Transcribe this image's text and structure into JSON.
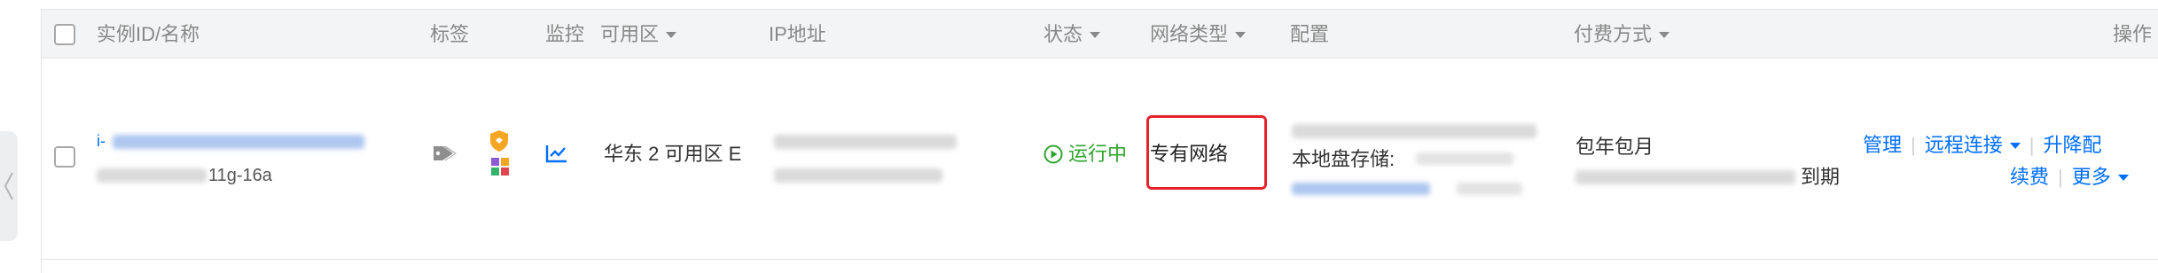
{
  "header": {
    "columns": {
      "instance": "实例ID/名称",
      "tags": "标签",
      "monitor": "监控",
      "zone": "可用区",
      "ip": "IP地址",
      "status": "状态",
      "network_type": "网络类型",
      "config": "配置",
      "billing": "付费方式",
      "actions": "操作"
    }
  },
  "row": {
    "instance_id_suffix": "11g-16a",
    "zone": "华东 2 可用区 E",
    "status": "运行中",
    "network_type": "专有网络",
    "local_disk_label": "本地盘存储:",
    "billing_type": "包年包月",
    "expire_suffix": "到期",
    "actions": {
      "manage": "管理",
      "remote_connect": "远程连接",
      "upgrade": "升降配",
      "renew": "续费",
      "more": "更多"
    }
  },
  "colors": {
    "link": "#006eff",
    "running": "#2fa52f",
    "highlight": "#e5212a",
    "header_bg": "#f3f4f5"
  },
  "icons": {
    "tag": "tag-icon",
    "shield": "shield-icon",
    "puzzle": "puzzle-icon",
    "monitor": "line-chart-icon",
    "play": "play-circle-icon",
    "collapse": "chevron-left-icon"
  }
}
